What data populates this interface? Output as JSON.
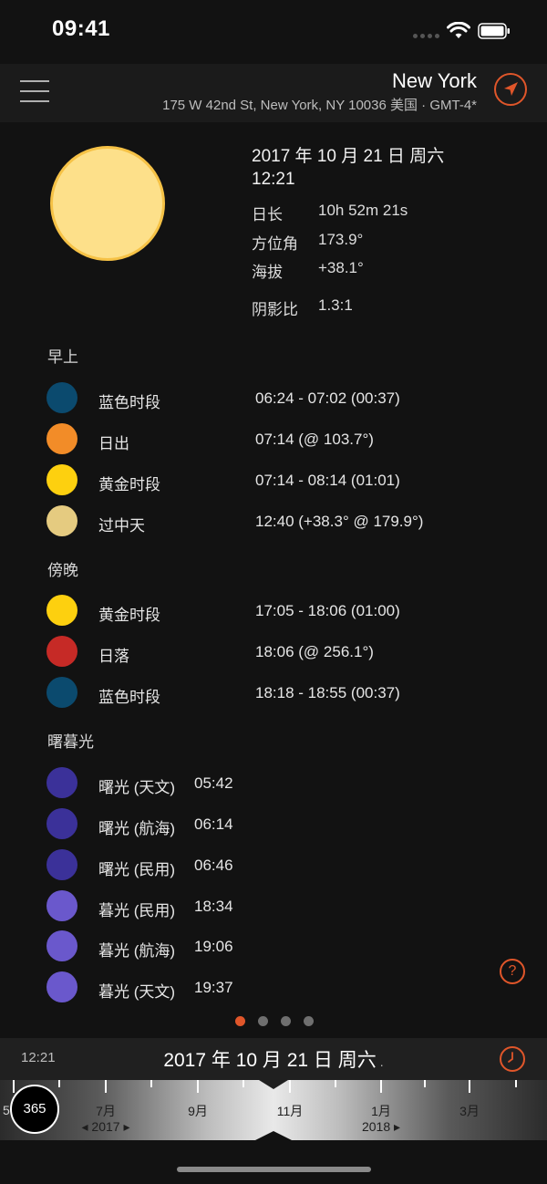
{
  "status_bar": {
    "time": "09:41"
  },
  "header": {
    "location_name": "New York",
    "address": "175 W 42nd St, New York, NY 10036 美国 · GMT-4*"
  },
  "sun_info": {
    "date": "2017 年 10 月 21 日 周六",
    "time": "12:21",
    "rows": [
      {
        "label": "日长",
        "value": "10h 52m 21s"
      },
      {
        "label": "方位角",
        "value": "173.9°"
      },
      {
        "label": "海拔",
        "value": "+38.1°"
      },
      {
        "label": "阴影比",
        "value": "1.3:1"
      }
    ]
  },
  "morning": {
    "title": "早上",
    "events": [
      {
        "label": "蓝色时段",
        "value": "06:24 - 07:02 (00:37)",
        "color": "#0b4a6e"
      },
      {
        "label": "日出",
        "value": "07:14 (@ 103.7°)",
        "color": "#f28c28"
      },
      {
        "label": "黄金时段",
        "value": "07:14 - 08:14 (01:01)",
        "color": "#fdd00f"
      },
      {
        "label": "过中天",
        "value": "12:40 (+38.3° @ 179.9°)",
        "color": "#e5cb80"
      }
    ]
  },
  "evening": {
    "title": "傍晚",
    "events": [
      {
        "label": "黄金时段",
        "value": "17:05 - 18:06 (01:00)",
        "color": "#fdd00f"
      },
      {
        "label": "日落",
        "value": "18:06 (@ 256.1°)",
        "color": "#c62a26"
      },
      {
        "label": "蓝色时段",
        "value": "18:18 - 18:55 (00:37)",
        "color": "#0b4a6e"
      }
    ]
  },
  "twilight": {
    "title": "曙暮光",
    "events": [
      {
        "label": "曙光 (天文)",
        "value": "05:42",
        "color": "#3b3199"
      },
      {
        "label": "曙光 (航海)",
        "value": "06:14",
        "color": "#3b3199"
      },
      {
        "label": "曙光 (民用)",
        "value": "06:46",
        "color": "#3b3199"
      },
      {
        "label": "暮光 (民用)",
        "value": "18:34",
        "color": "#6a58cc"
      },
      {
        "label": "暮光 (航海)",
        "value": "19:06",
        "color": "#6a58cc"
      },
      {
        "label": "暮光 (天文)",
        "value": "19:37",
        "color": "#6a58cc"
      }
    ]
  },
  "help_label": "?",
  "pagination": {
    "count": 4,
    "active": 0
  },
  "date_bar": {
    "time": "12:21",
    "date": "2017 年 10 月 21 日 周六",
    "date_suffix": "."
  },
  "timeline": {
    "day_of_year": "365",
    "edge_label": "5",
    "months": [
      "7月",
      "9月",
      "11月",
      "1月",
      "3月"
    ],
    "years": [
      "◂ 2017 ▸",
      "2018 ▸"
    ]
  }
}
